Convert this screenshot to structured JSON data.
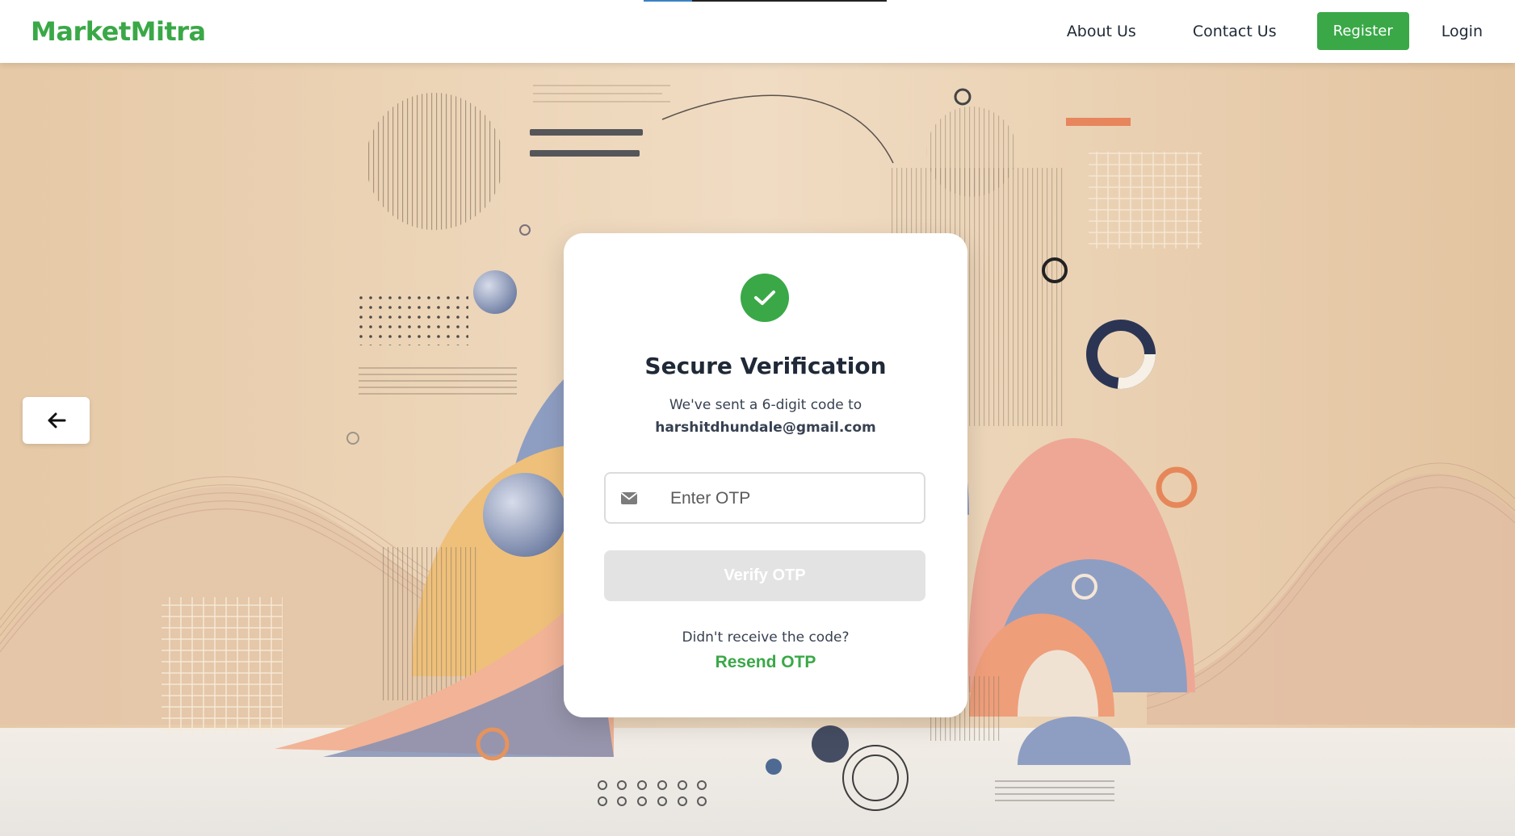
{
  "navbar": {
    "brand": "MarketMitra",
    "links": {
      "about": "About Us",
      "contact": "Contact Us",
      "register": "Register",
      "login": "Login"
    }
  },
  "back_button": {
    "icon": "arrow-left-icon"
  },
  "card": {
    "status_icon": "check-circle-icon",
    "title": "Secure Verification",
    "subtitle": "We've sent a 6-digit code to",
    "email": "harshitdhundale@gmail.com",
    "otp_input": {
      "placeholder": "Enter OTP",
      "value": "",
      "icon": "envelope-icon"
    },
    "verify_label": "Verify OTP",
    "resend_prompt": "Didn't receive the code?",
    "resend_label": "Resend OTP"
  },
  "colors": {
    "brand_green": "#3aa847",
    "disabled_button": "#e3e3e3",
    "background": "#e9d3b8"
  }
}
